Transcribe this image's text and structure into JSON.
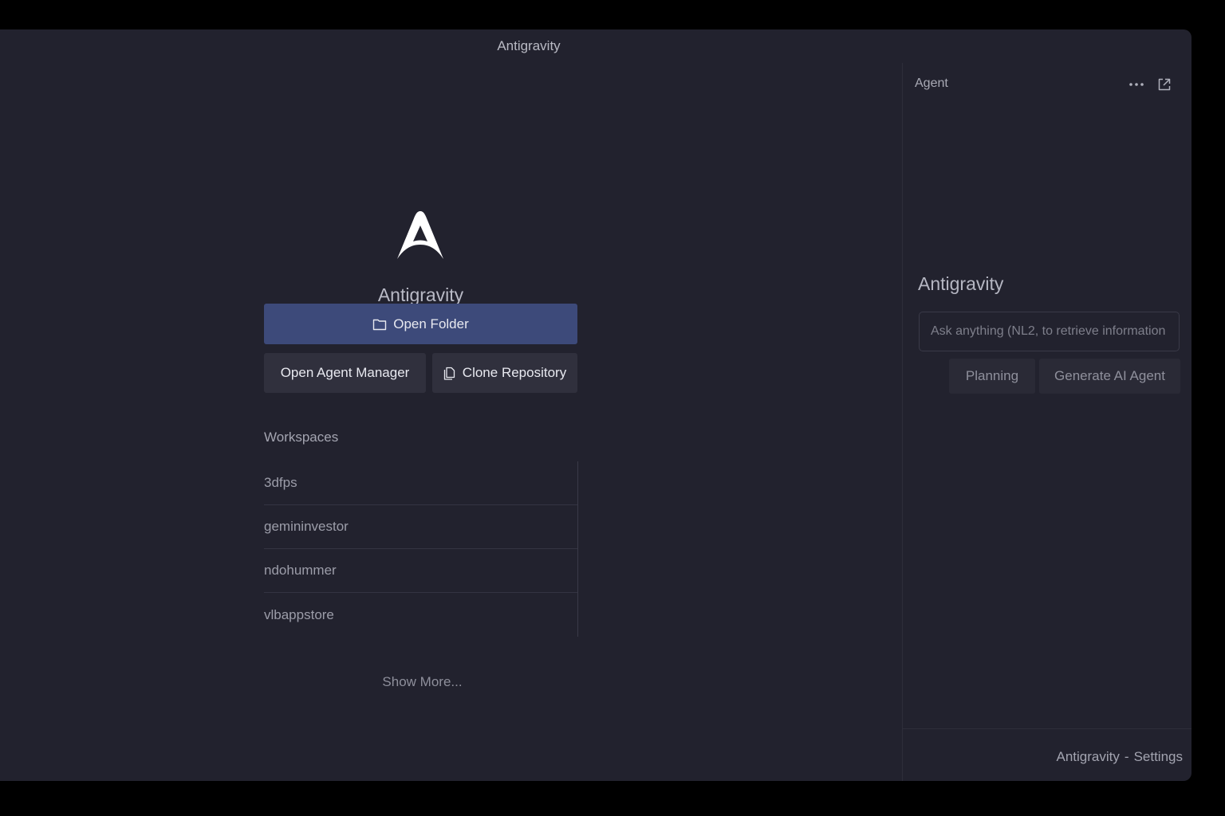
{
  "window": {
    "title": "Antigravity"
  },
  "welcome": {
    "logo_icon": "antigravity-logo-icon",
    "app_name": "Antigravity",
    "open_folder_label": "Open Folder",
    "open_folder_icon": "folder-icon",
    "open_agent_manager_label": "Open Agent Manager",
    "clone_repository_label": "Clone Repository",
    "clone_repository_icon": "file-copy-icon"
  },
  "workspaces": {
    "label": "Workspaces",
    "items": [
      {
        "name": "3dfps"
      },
      {
        "name": "gemininvestor"
      },
      {
        "name": "ndohummer"
      },
      {
        "name": "vlbappstore"
      }
    ],
    "show_more_label": "Show More..."
  },
  "agent": {
    "header_title": "Agent",
    "more_icon": "more-horizontal-icon",
    "popout_icon": "external-link-icon",
    "title": "Antigravity",
    "input_placeholder": "Ask anything (NL2, to retrieve information",
    "planning_label": "Planning",
    "generate_label": "Generate AI Agent",
    "footer_app": "Antigravity",
    "footer_separator": "-",
    "footer_settings": "Settings"
  },
  "colors": {
    "background": "#22222e",
    "primary_button": "#3d4a7a",
    "secondary_button": "#30303d"
  }
}
